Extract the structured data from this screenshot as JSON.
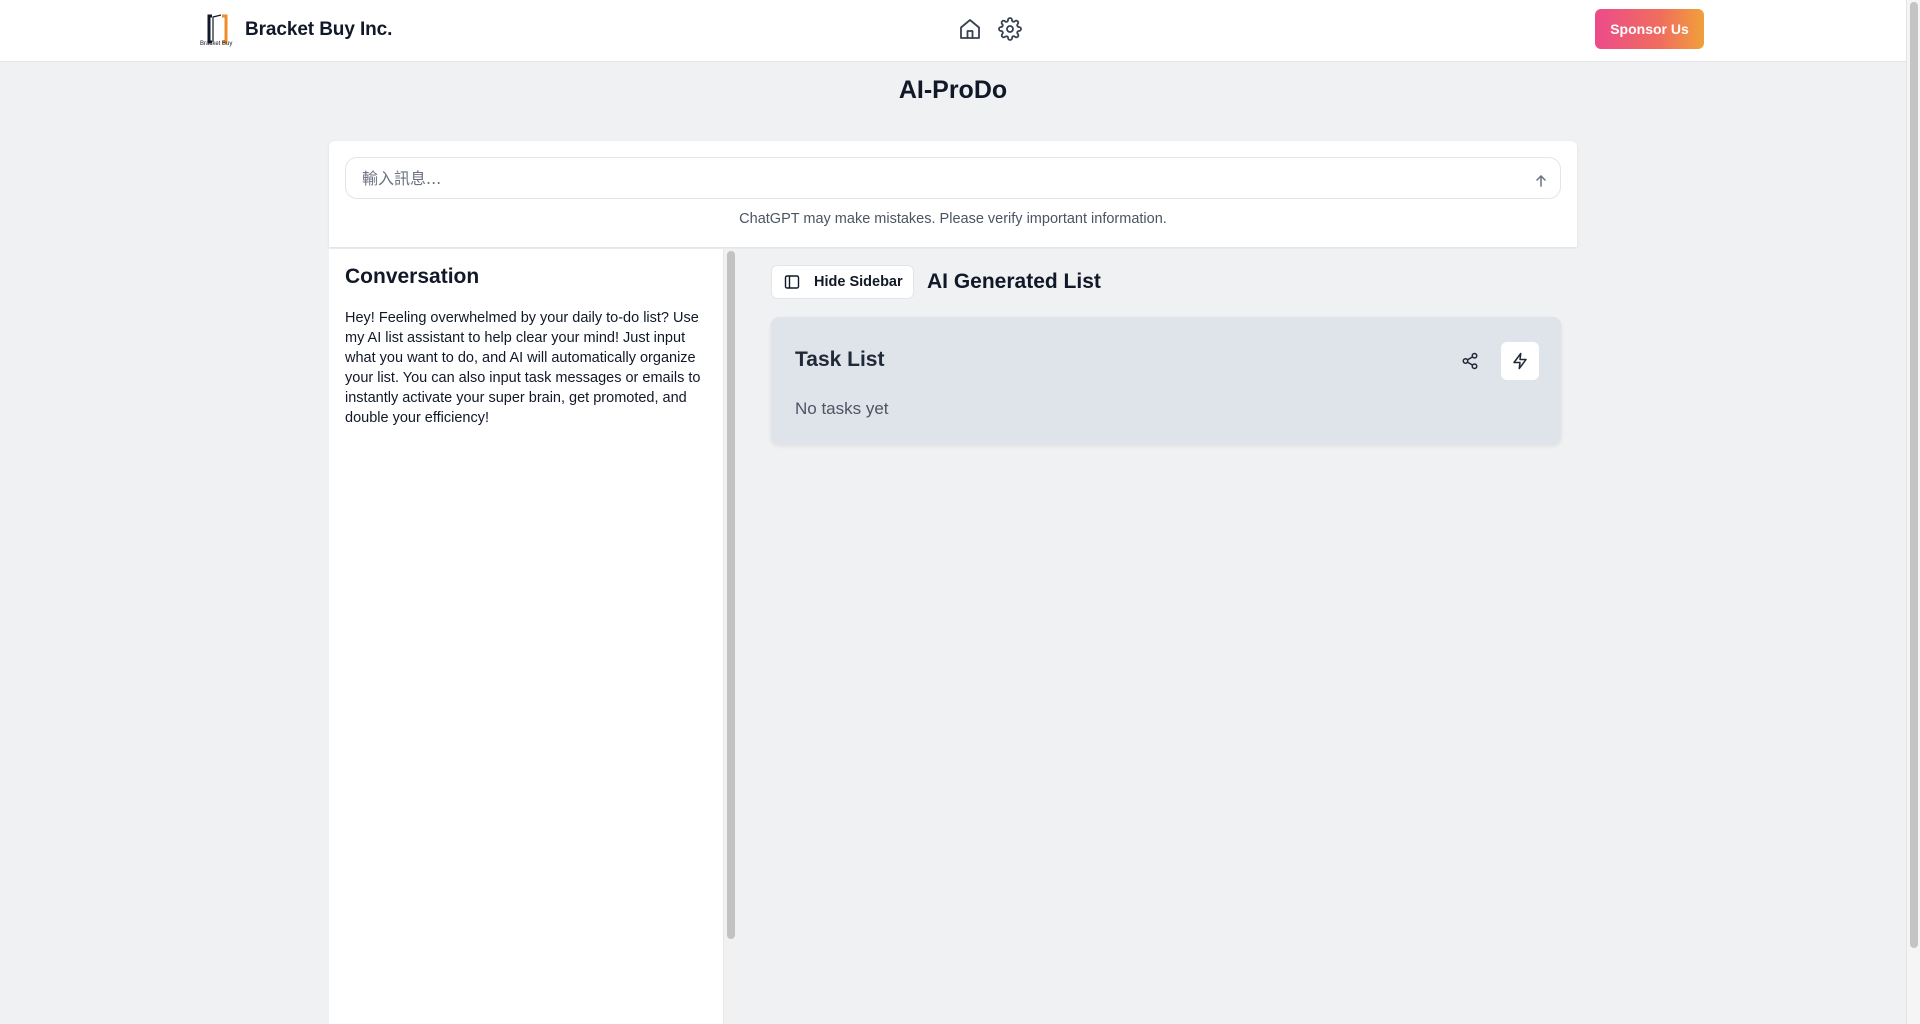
{
  "header": {
    "brand_name": "Bracket Buy Inc.",
    "logo_text": "Bracket Buy",
    "nav_icons": [
      "home-icon",
      "gear-icon"
    ],
    "sponsor_label": "Sponsor Us",
    "sponsor_colors": [
      "#ec4b8a",
      "#f0a13a"
    ]
  },
  "page": {
    "title": "AI-ProDo"
  },
  "composer": {
    "placeholder": "輸入訊息...",
    "value": "",
    "disclaimer": "ChatGPT may make mistakes. Please verify important information."
  },
  "sidebar": {
    "title": "Conversation",
    "message": "Hey! Feeling overwhelmed by your daily to-do list? Use my AI list assistant to help clear your mind! Just input what you want to do, and AI will automatically organize your list. You can also input task messages or emails to instantly activate your super brain, get promoted, and double your efficiency!"
  },
  "main": {
    "hide_sidebar_label": "Hide Sidebar",
    "heading": "AI Generated List",
    "task_card": {
      "title": "Task List",
      "empty_text": "No tasks yet",
      "icons": [
        "share-icon",
        "bolt-icon"
      ]
    }
  },
  "colors": {
    "accent_orange": "#f28c28",
    "card_bg": "#dfe3ea",
    "page_bg": "#f0f1f3"
  }
}
